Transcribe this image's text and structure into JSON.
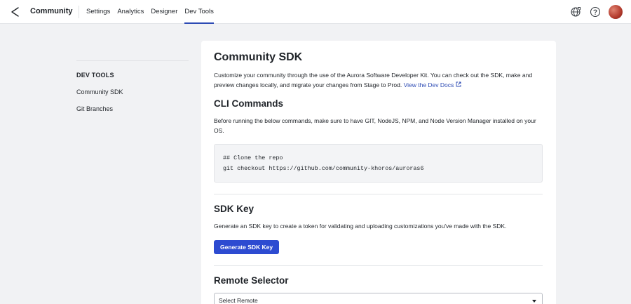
{
  "header": {
    "brand": "Community",
    "nav": [
      "Settings",
      "Analytics",
      "Designer",
      "Dev Tools"
    ],
    "active_nav": "Dev Tools",
    "icons": [
      "globe-icon",
      "help-icon"
    ],
    "accent_color": "#2d4bb4"
  },
  "sidebar": {
    "title": "DEV TOOLS",
    "items": [
      "Community SDK",
      "Git Branches"
    ]
  },
  "main": {
    "title": "Community SDK",
    "intro": "Customize your community through the use of the Aurora Software Developer Kit. You can check out the SDK, make and preview changes locally, and migrate your changes from Stage to Prod.",
    "docs_link": "View the Dev Docs",
    "cli": {
      "title": "CLI Commands",
      "description": "Before running the below commands, make sure to have GIT, NodeJS, NPM, and Node Version Manager installed on your OS.",
      "code_line1": "## Clone the repo",
      "code_line2": "git checkout https://github.com/community-khoros/auroras6"
    },
    "sdk_key": {
      "title": "SDK Key",
      "description": "Generate an SDK key to create a token for validating and uploading customizations you've made with the SDK.",
      "button": "Generate SDK Key",
      "button_color": "#2d4bd1"
    },
    "remote": {
      "title": "Remote Selector",
      "placeholder": "Select Remote"
    }
  }
}
